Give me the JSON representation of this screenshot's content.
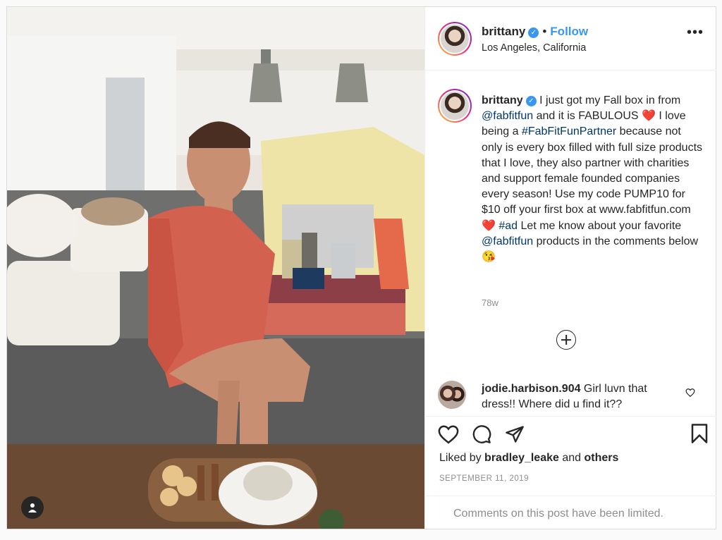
{
  "post": {
    "username": "brittany",
    "follow_label": "Follow",
    "location": "Los Angeles, California",
    "more_label": "•••",
    "dot_separator": "•"
  },
  "caption": {
    "username": "brittany",
    "p1": " I just got my Fall box in from ",
    "mention1": "@fabfitfun",
    "p2": " and it is FABULOUS ",
    "heart1": "❤️",
    "p3": " I love being a ",
    "hashtag1": "#FabFitFunPartner",
    "p4": " because not only is every box filled with full size products that I love, they also partner with charities and support female founded companies every season! Use my code PUMP10 for $10 off your first box at www.fabfitfun.com ",
    "heart2": "❤️",
    "p5": " ",
    "hashtag2": "#ad",
    "p6": " Let me know about your favorite ",
    "mention2": "@fabfitfun",
    "p7": " products in the comments below ",
    "emoji_end": "😘",
    "time": "78w"
  },
  "comment": {
    "username": "jodie.harbison.904",
    "text": " Girl luvn that dress!! Where did u find it??"
  },
  "footer": {
    "liked_by_prefix": "Liked by ",
    "liked_by_user": "bradley_leake",
    "and_label": " and ",
    "others_label": "others",
    "date": "SEPTEMBER 11, 2019",
    "limited_text": "Comments on this post have been limited."
  },
  "icons": {
    "heart": "heart-icon",
    "comment": "comment-icon",
    "share": "share-icon",
    "save": "bookmark-icon",
    "add": "plus-circle-icon",
    "tag": "user-tag-icon",
    "verified": "verified-badge-icon"
  },
  "colors": {
    "link": "#00376b",
    "follow": "#3897f0",
    "muted": "#8e8e8e",
    "border": "#dbdbdb"
  }
}
